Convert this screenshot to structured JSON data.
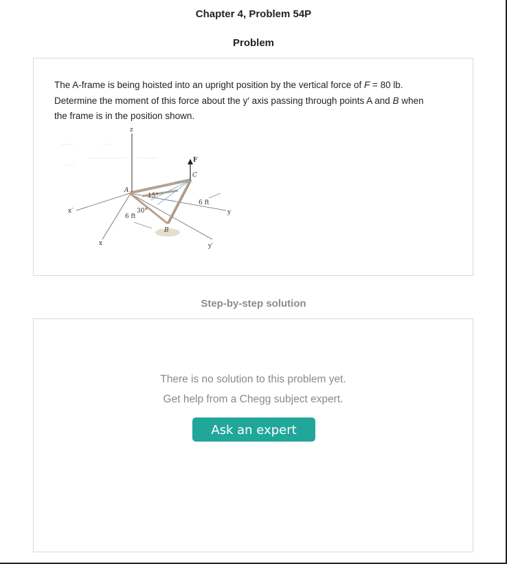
{
  "header": {
    "chapter_title": "Chapter 4, Problem 54P",
    "problem_heading": "Problem"
  },
  "problem": {
    "line1_a": "The A-frame is being hoisted into an upright position by the vertical force of ",
    "force_var": "F",
    "line1_b": " = 80 lb.",
    "line2_a": "Determine the moment of this force about the y′ axis passing through points A and ",
    "point_b": "B",
    "line2_b": " when",
    "line3": "the frame is in the position shown."
  },
  "figure": {
    "label_z": "z",
    "label_F": "F",
    "label_C": "C",
    "label_A": "A",
    "label_B": "B",
    "angle_15": "15°",
    "angle_30": "30°",
    "dim_6ft_left": "6 ft",
    "dim_6ft_right": "6 ft",
    "label_x": "x",
    "label_xprime": "x′",
    "label_y": "y",
    "label_yprime": "y′"
  },
  "solution": {
    "heading": "Step-by-step solution",
    "no_solution_text": "There is no solution to this problem yet.",
    "get_help_text": "Get help from a Chegg subject expert.",
    "ask_button_label": "Ask an expert",
    "button_color": "#21a69a"
  }
}
